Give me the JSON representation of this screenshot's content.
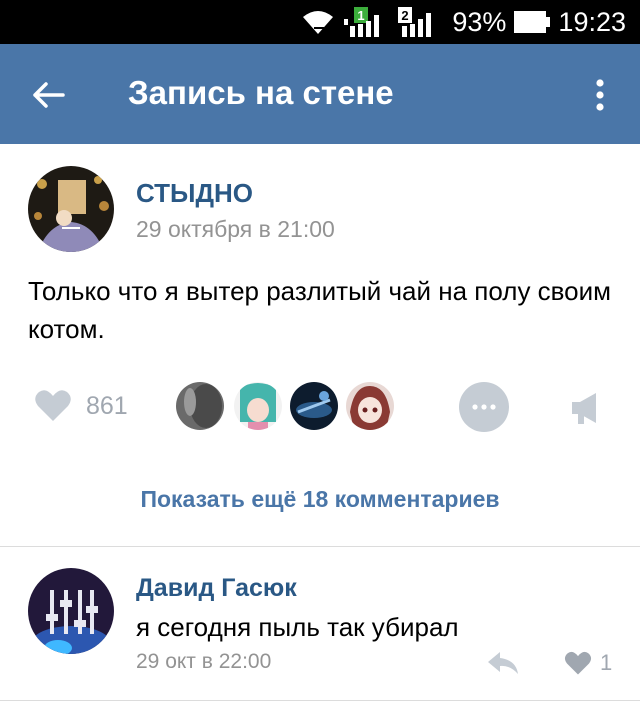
{
  "status_bar": {
    "sim1_label": "1",
    "sim2_label": "2",
    "battery": "93%",
    "time": "19:23"
  },
  "app_bar": {
    "title": "Запись на стене"
  },
  "post": {
    "author": "СТЫДНО",
    "date": "29 октября в 21:00",
    "text": "Только что я вытер разлитый чай на полу своим котом.",
    "likes": "861"
  },
  "show_more": "Показать ещё 18 комментариев",
  "comment": {
    "author": "Давид Гасюк",
    "text": "я сегодня пыль так убирал",
    "date": "29 окт в 22:00",
    "likes": "1"
  },
  "colors": {
    "header": "#4a76a8",
    "link": "#2a5885",
    "muted": "#939393",
    "icon_gray": "#c5ccd4"
  },
  "icons": [
    "wifi-icon",
    "signal-icon",
    "battery-icon",
    "back-arrow-icon",
    "more-vert-icon",
    "heart-icon",
    "more-horiz-icon",
    "megaphone-icon",
    "reply-icon"
  ]
}
